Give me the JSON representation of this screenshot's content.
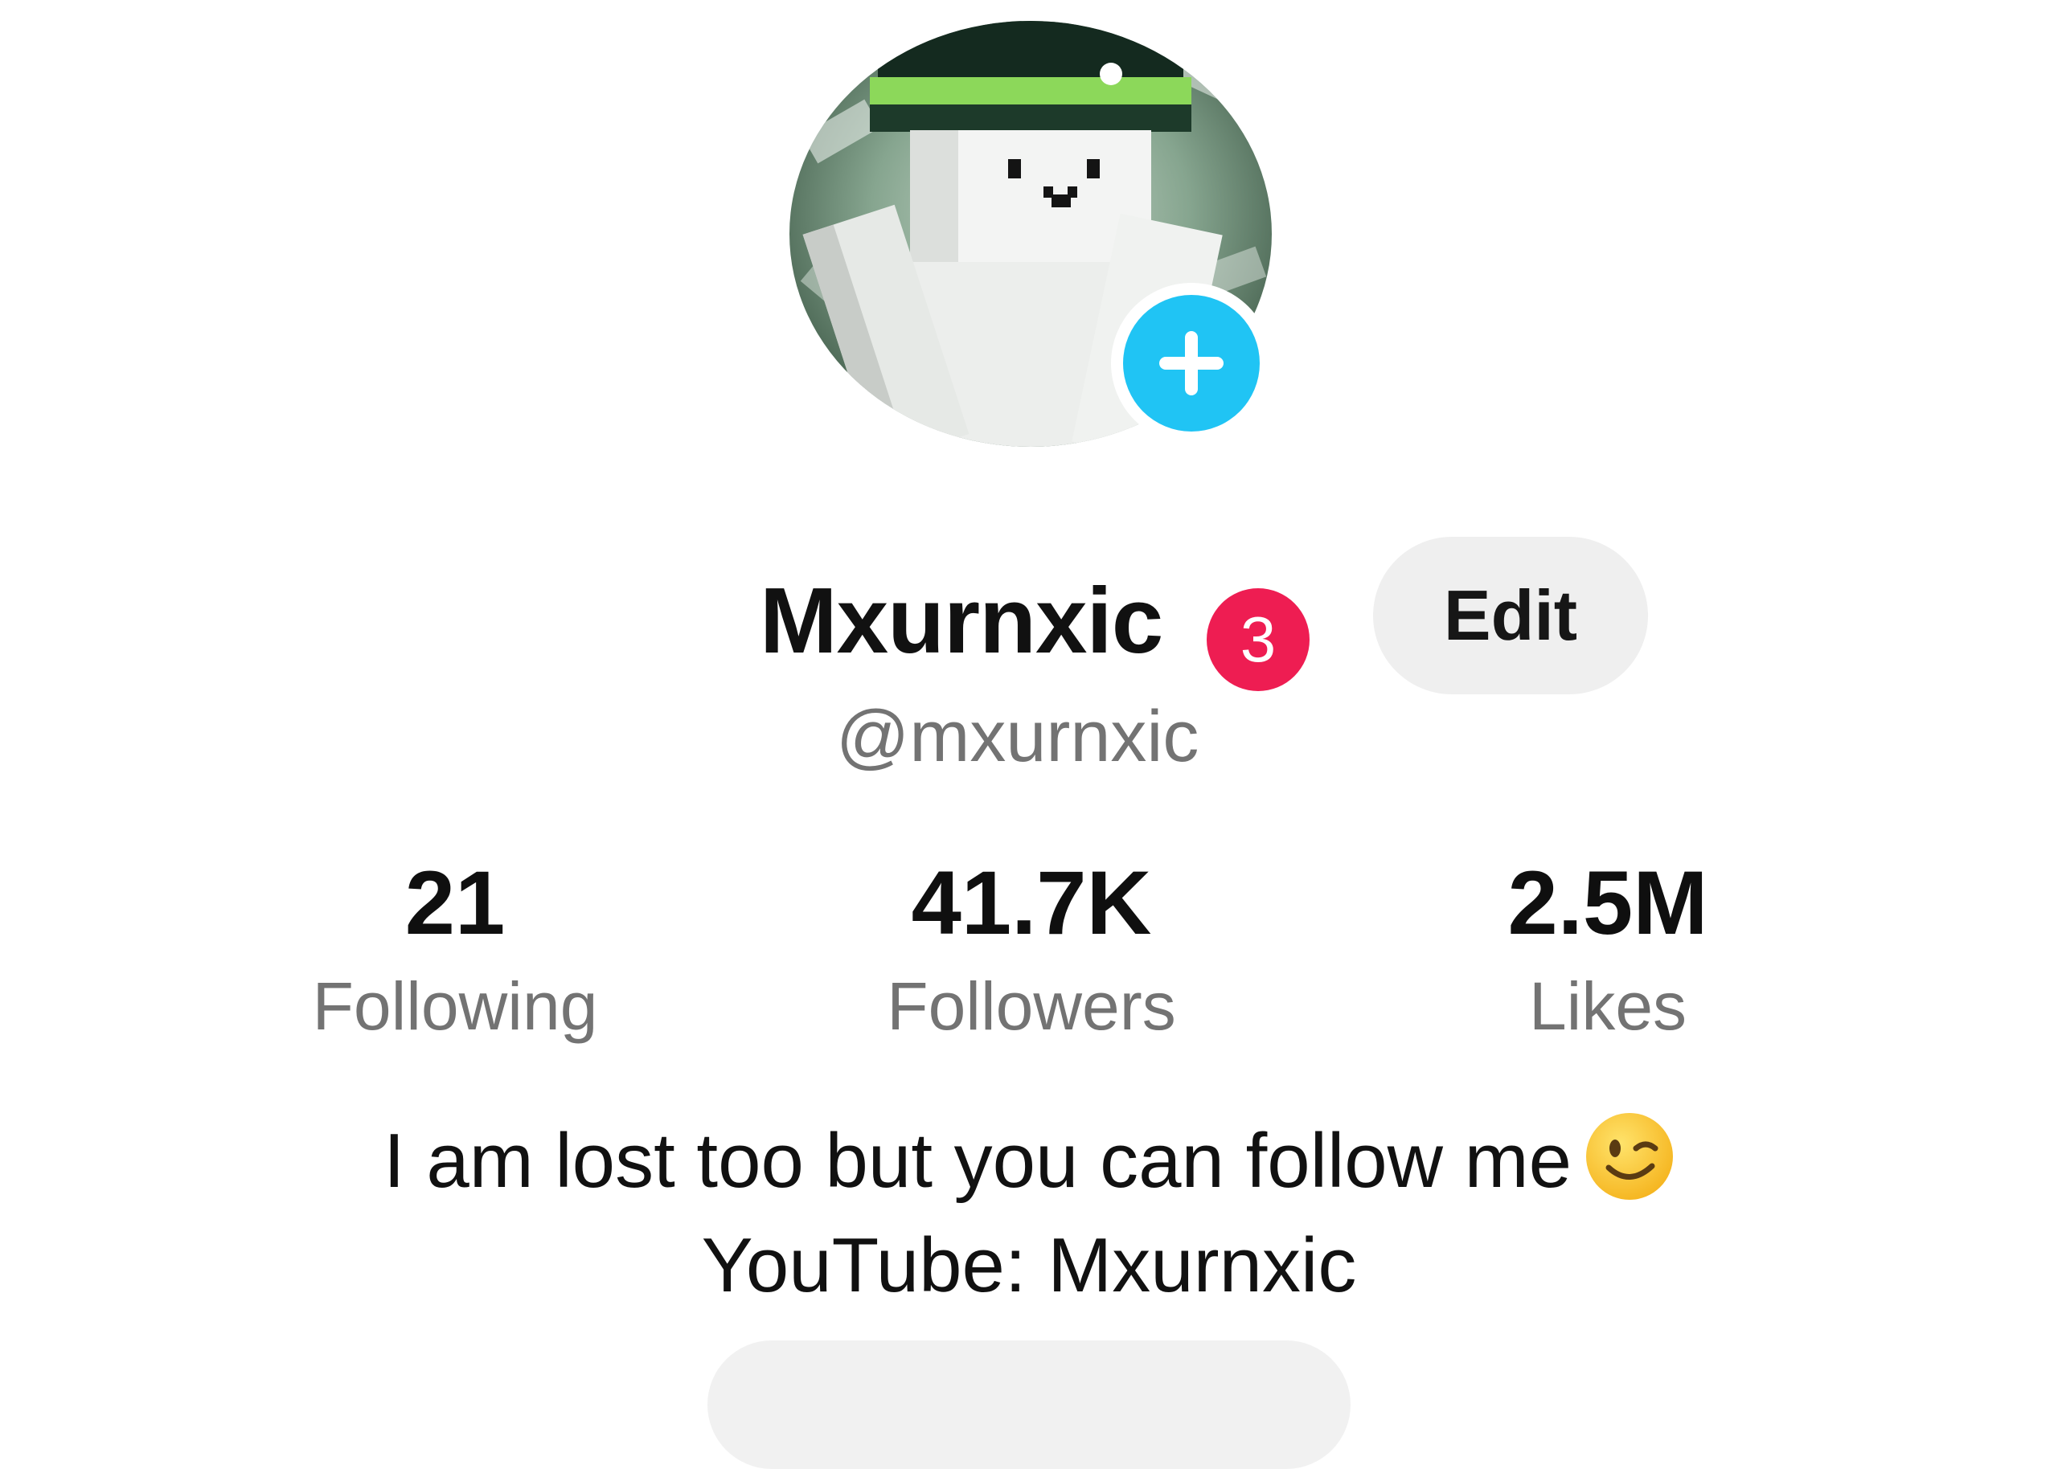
{
  "profile": {
    "display_name": "Mxurnxic",
    "username": "@mxurnxic",
    "notification_count": "3",
    "edit_label": "Edit",
    "avatar_icon": "add-follow-plus-icon"
  },
  "stats": {
    "following": {
      "value": "21",
      "label": "Following"
    },
    "followers": {
      "value": "41.7K",
      "label": "Followers"
    },
    "likes": {
      "value": "2.5M",
      "label": "Likes"
    }
  },
  "bio": {
    "line1": "I am lost too but you can follow me",
    "line2": "YouTube: Mxurnxic",
    "emoji": "winking-face-emoji"
  },
  "colors": {
    "accent_blue": "#20c4f4",
    "badge_red": "#ee1d52",
    "secondary_text": "#737373",
    "button_bg": "#efefef"
  }
}
